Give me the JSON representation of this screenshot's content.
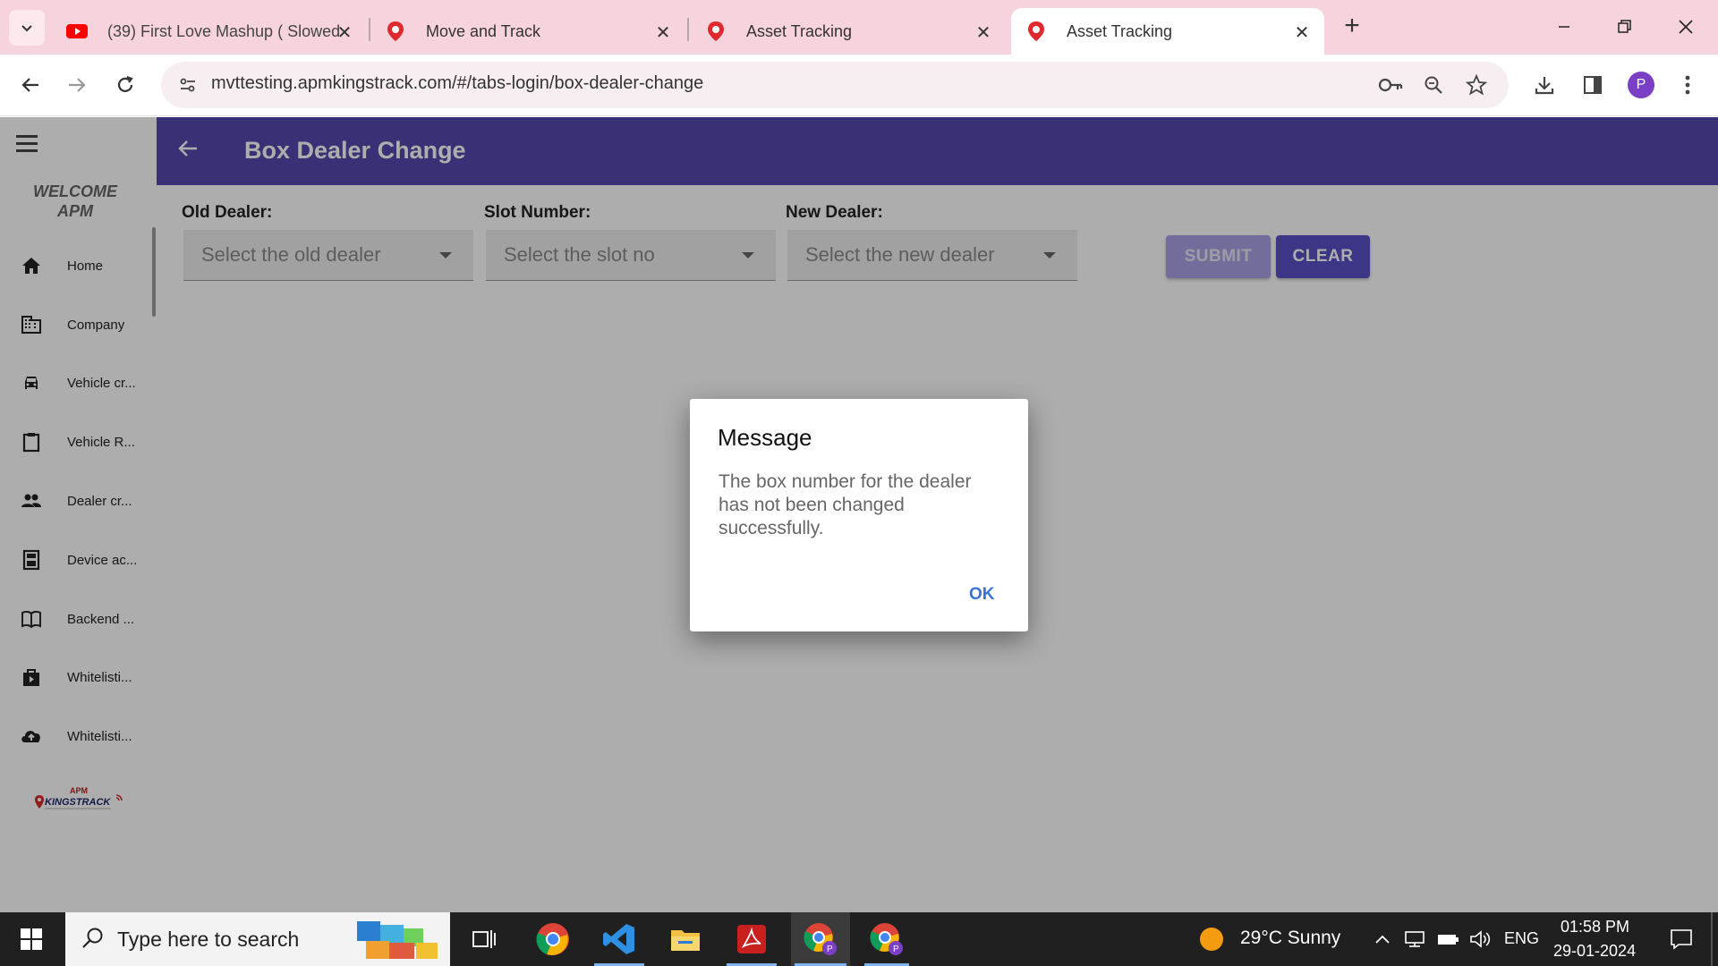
{
  "browser": {
    "tabs": [
      {
        "label": "(39) First Love Mashup ( Slowed"
      },
      {
        "label": "Move and Track"
      },
      {
        "label": "Asset Tracking"
      },
      {
        "label": "Asset Tracking"
      }
    ],
    "url": "mvttesting.apmkingstrack.com/#/tabs-login/box-dealer-change",
    "profile_initial": "P"
  },
  "sidebar": {
    "welcome_line1": "WELCOME",
    "welcome_line2": "APM",
    "items": [
      {
        "label": "Home",
        "icon": "home-icon"
      },
      {
        "label": "Company",
        "icon": "company-icon"
      },
      {
        "label": "Vehicle cr...",
        "icon": "car-icon"
      },
      {
        "label": "Vehicle R...",
        "icon": "clipboard-icon"
      },
      {
        "label": "Dealer cr...",
        "icon": "people-icon"
      },
      {
        "label": "Device ac...",
        "icon": "calculator-icon"
      },
      {
        "label": "Backend ...",
        "icon": "book-icon"
      },
      {
        "label": "Whitelisti...",
        "icon": "shopping-bag-icon"
      },
      {
        "label": "Whitelisti...",
        "icon": "cloud-upload-icon"
      }
    ],
    "logo_text_top": "APM",
    "logo_text": "KINGSTRACK"
  },
  "header": {
    "title": "Box Dealer Change"
  },
  "form": {
    "old_dealer_label": "Old Dealer:",
    "old_dealer_placeholder": "Select the old dealer",
    "slot_label": "Slot Number:",
    "slot_placeholder": "Select the slot no",
    "new_dealer_label": "New Dealer:",
    "new_dealer_placeholder": "Select the new dealer",
    "submit_label": "SUBMIT",
    "clear_label": "CLEAR"
  },
  "dialog": {
    "title": "Message",
    "message": "The box number for the dealer has not been changed successfully.",
    "ok_label": "OK"
  },
  "taskbar": {
    "search_placeholder": "Type here to search",
    "weather": "29°C  Sunny",
    "language": "ENG",
    "time": "01:58 PM",
    "date": "29-01-2024"
  },
  "colors": {
    "header": "#5549ad",
    "clear_button": "#5a4ec6",
    "ok_text": "#3875d7",
    "tabstrip": "#f7d4dd"
  }
}
